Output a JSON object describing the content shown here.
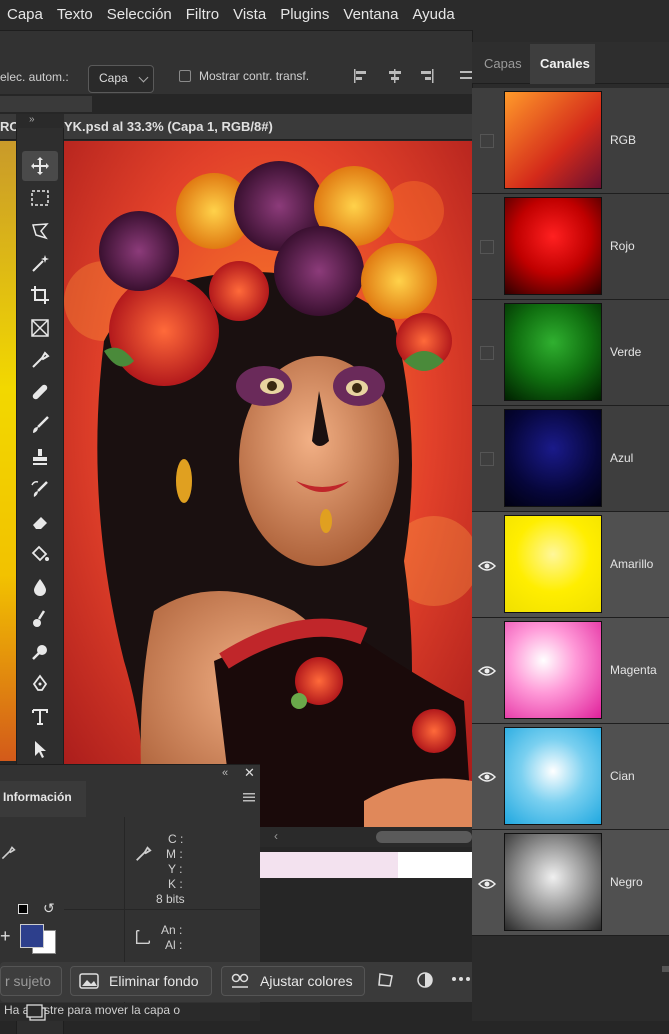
{
  "menubar": {
    "items": [
      "Capa",
      "Texto",
      "Selección",
      "Filtro",
      "Vista",
      "Plugins",
      "Ventana",
      "Ayuda"
    ]
  },
  "options": {
    "auto_select_label": "elec. autom.:",
    "auto_select_value": "Capa",
    "transform_label": "Mostrar contr. transf."
  },
  "document": {
    "tab_left": "RO",
    "tab_title": "YK.psd al 33.3% (Capa 1, RGB/8#)"
  },
  "tools": [
    "move-tool",
    "marquee-tool",
    "lasso-tool",
    "magic-wand-tool",
    "crop-tool",
    "frame-tool",
    "eyedropper-tool",
    "healing-tool",
    "brush-tool",
    "stamp-tool",
    "history-brush-tool",
    "eraser-tool",
    "paint-bucket-tool",
    "blur-tool",
    "smudge-tool",
    "dodge-tool",
    "pen-tool",
    "type-tool",
    "path-select-tool",
    "shape-tool",
    "hand-tool",
    "zoom-tool",
    "more-tools"
  ],
  "info_panel": {
    "tab": "Información",
    "cmyk": {
      "c": "C :",
      "m": "M :",
      "y": "Y :",
      "k": "K :"
    },
    "bits": "8 bits",
    "size": {
      "w": "An :",
      "h": "Al :"
    }
  },
  "taskbar": {
    "subject_label": "r sujeto",
    "remove_bg_label": "Eliminar fondo",
    "adjust_colors_label": "Ajustar colores"
  },
  "hint": "Ha  arrastre para mover la capa o",
  "right_panel": {
    "tabs": [
      "Capas",
      "Canales"
    ],
    "active_tab": "Canales",
    "channels": [
      {
        "name": "RGB",
        "visible": false
      },
      {
        "name": "Rojo",
        "visible": false
      },
      {
        "name": "Verde",
        "visible": false
      },
      {
        "name": "Azul",
        "visible": false
      },
      {
        "name": "Amarillo",
        "visible": true
      },
      {
        "name": "Magenta",
        "visible": true
      },
      {
        "name": "Cian",
        "visible": true
      },
      {
        "name": "Negro",
        "visible": true
      }
    ]
  },
  "colors": {
    "foreground": "#2d3f8c",
    "background": "#ffffff",
    "accent": "#e6e6e6"
  }
}
